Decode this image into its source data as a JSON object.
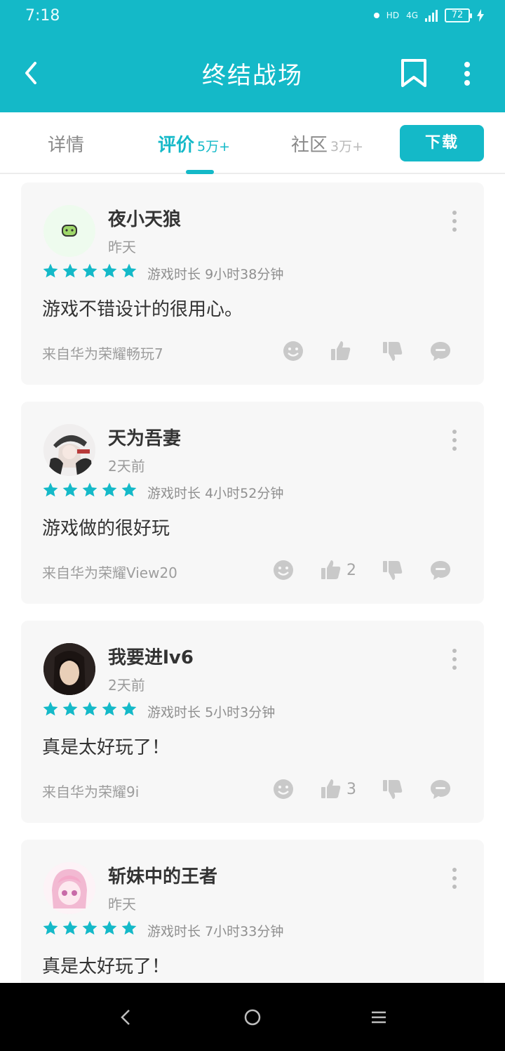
{
  "status_bar": {
    "time": "7:18",
    "network": "4G",
    "hd": "HD",
    "battery": "72"
  },
  "header": {
    "title": "终结战场"
  },
  "tabs": [
    {
      "label": "详情",
      "count": ""
    },
    {
      "label": "评价",
      "count": "5万+"
    },
    {
      "label": "社区",
      "count": "3万+"
    }
  ],
  "download_label": "下载",
  "reviews": [
    {
      "username": "夜小天狼",
      "date": "昨天",
      "rating": 5,
      "playtime_label": "游戏时长",
      "playtime": "9小时38分钟",
      "content": "游戏不错设计的很用心。",
      "device": "来自华为荣耀畅玩7",
      "likes": ""
    },
    {
      "username": "天为吾妻",
      "date": "2天前",
      "rating": 5,
      "playtime_label": "游戏时长",
      "playtime": "4小时52分钟",
      "content": "游戏做的很好玩",
      "device": "来自华为荣耀View20",
      "likes": "2"
    },
    {
      "username": "我要进lv6",
      "date": "2天前",
      "rating": 5,
      "playtime_label": "游戏时长",
      "playtime": "5小时3分钟",
      "content": "真是太好玩了！",
      "device": "来自华为荣耀9i",
      "likes": "3"
    },
    {
      "username": "斩妹中的王者",
      "date": "昨天",
      "rating": 5,
      "playtime_label": "游戏时长",
      "playtime": "7小时33分钟",
      "content": "真是太好玩了！",
      "device": "",
      "likes": ""
    }
  ],
  "colors": {
    "accent": "#14b9c8",
    "star": "#14b9c8",
    "card_bg": "#f7f7f7"
  },
  "icons": [
    "back-arrow-icon",
    "bookmark-icon",
    "more-vert-icon",
    "star-icon",
    "emoji-icon",
    "thumb-up-icon",
    "thumb-down-icon",
    "comment-icon"
  ]
}
